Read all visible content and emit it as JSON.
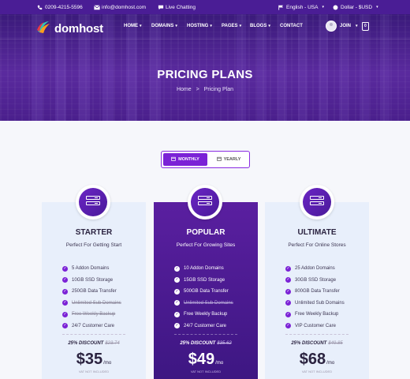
{
  "topbar": {
    "phone": "0209-4215-5596",
    "email": "info@domhost.com",
    "chat": "Live Chatting",
    "language": "English - USA",
    "currency": "Dollar - $USD"
  },
  "brand": {
    "name": "domhost"
  },
  "nav": {
    "items": [
      "HOME",
      "DOMAINS",
      "HOSTING",
      "PAGES",
      "BLOGS",
      "CONTACT"
    ],
    "join": "JOIN",
    "cart_count": "0"
  },
  "hero": {
    "title": "PRICING PLANS",
    "breadcrumb_home": "Home",
    "breadcrumb_sep": ">",
    "breadcrumb_current": "Pricing Plan"
  },
  "toggle": {
    "monthly": "MONTHLY",
    "yearly": "YEARLY",
    "active": "monthly"
  },
  "plans": [
    {
      "name": "STARTER",
      "subtitle": "Perfect For Getting Start",
      "features": [
        {
          "text": "5 Addon Domains",
          "included": true
        },
        {
          "text": "10GB SSD Storage",
          "included": true
        },
        {
          "text": "250GB Data Transfer",
          "included": true
        },
        {
          "text": "Unlimited Sub Domains",
          "included": false
        },
        {
          "text": "Free Weekly Backup",
          "included": false
        },
        {
          "text": "24/7 Customer Care",
          "included": true
        }
      ],
      "discount": "25% DISCOUNT",
      "old_price": "$23.74",
      "price": "$35",
      "per": "/mo",
      "vat": "VAT NOT INCLUDED"
    },
    {
      "name": "POPULAR",
      "subtitle": "Perfect For Growing Sites",
      "features": [
        {
          "text": "10 Addon Domains",
          "included": true
        },
        {
          "text": "15GB SSD Storage",
          "included": true
        },
        {
          "text": "500GB Data Transfer",
          "included": true
        },
        {
          "text": "Unlimited Sub Domains",
          "included": false
        },
        {
          "text": "Free Weekly Backup",
          "included": true
        },
        {
          "text": "24/7 Customer Care",
          "included": true
        }
      ],
      "discount": "25% DISCOUNT",
      "old_price": "$35.62",
      "price": "$49",
      "per": "/mo",
      "vat": "VAT NOT INCLUDED"
    },
    {
      "name": "ULTIMATE",
      "subtitle": "Perfect For Online Stores",
      "features": [
        {
          "text": "25 Addon Domains",
          "included": true
        },
        {
          "text": "30GB SSD Storage",
          "included": true
        },
        {
          "text": "800GB Data Transfer",
          "included": true
        },
        {
          "text": "Unlimited Sub Domains",
          "included": true
        },
        {
          "text": "Free Weekly Backup",
          "included": true
        },
        {
          "text": "VIP Customer Care",
          "included": true
        }
      ],
      "discount": "25% DISCOUNT",
      "old_price": "$49.85",
      "price": "$68",
      "per": "/mo",
      "vat": "VAT NOT INCLUDED"
    }
  ],
  "colors": {
    "brand_purple": "#4a1d95",
    "accent": "#7b22d6",
    "card_bg": "#e8effb"
  }
}
